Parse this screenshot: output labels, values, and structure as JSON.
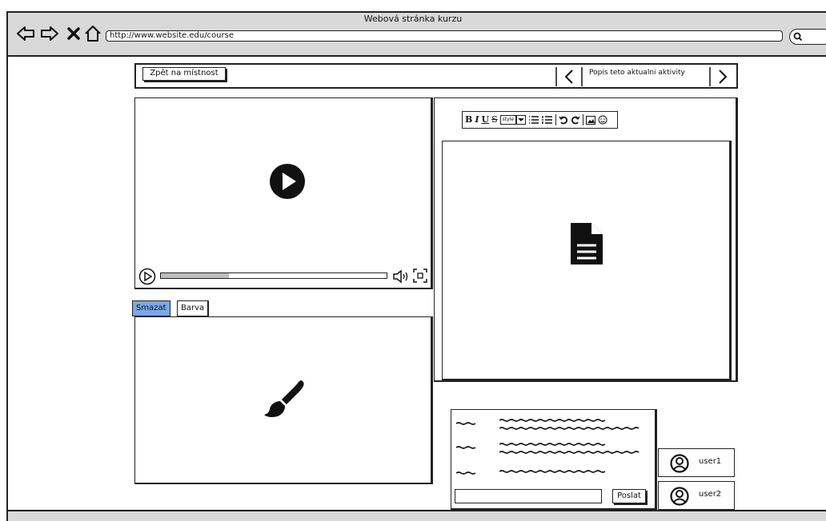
{
  "browser": {
    "title": "Webová stránka kurzu",
    "url": "http://www.website.edu/course",
    "nav_icons": [
      "back-arrow-icon",
      "forward-arrow-icon",
      "close-icon",
      "home-icon"
    ]
  },
  "topbar": {
    "back_label": "Zpět na místnost",
    "activity_label": "Popis teto aktualni aktivity"
  },
  "video": {
    "progress_fraction": 0.3
  },
  "drawing": {
    "tabs": [
      "Smazat",
      "Barva"
    ],
    "active_tab_color": "#7aa8e8"
  },
  "editor": {
    "toolbar": {
      "bold": "B",
      "italic": "I",
      "underline": "U",
      "strike": "S",
      "style": "style"
    }
  },
  "chat": {
    "send_label": "Poslat",
    "input_value": ""
  },
  "users": [
    "user1",
    "user2"
  ]
}
